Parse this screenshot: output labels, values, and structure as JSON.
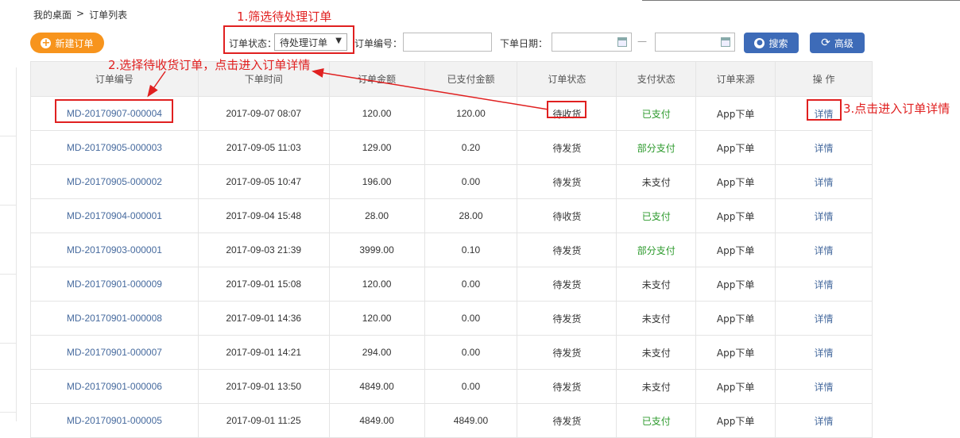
{
  "breadcrumb": {
    "home": "我的桌面",
    "separator": ">",
    "current": "订单列表"
  },
  "toolbar": {
    "new_order_label": "新建订单",
    "status_label": "订单状态：",
    "status_selected": "待处理订单",
    "order_no_label": "订单编号：",
    "order_no_value": "",
    "date_label": "下单日期：",
    "date_separator": "—",
    "date_from": "",
    "date_to": "",
    "search_label": "搜索",
    "advanced_label": "高级"
  },
  "annotations": {
    "step1": "1.筛选待处理订单",
    "step2": "2.选择待收货订单，点击进入订单详情",
    "step3": "3.点击进入订单详情",
    "color": "#e02020"
  },
  "table": {
    "columns": [
      "订单编号",
      "下单时间",
      "订单金额",
      "已支付金额",
      "订单状态",
      "支付状态",
      "订单来源",
      "操 作"
    ],
    "rows": [
      {
        "order_no": "MD-20170907-000004",
        "time": "2017-09-07 08:07",
        "amount": "120.00",
        "paid_amount": "120.00",
        "status": "待收货",
        "pay_status": "已支付",
        "source": "App下单",
        "action": "详情"
      },
      {
        "order_no": "MD-20170905-000003",
        "time": "2017-09-05 11:03",
        "amount": "129.00",
        "paid_amount": "0.20",
        "status": "待发货",
        "pay_status": "部分支付",
        "source": "App下单",
        "action": "详情"
      },
      {
        "order_no": "MD-20170905-000002",
        "time": "2017-09-05 10:47",
        "amount": "196.00",
        "paid_amount": "0.00",
        "status": "待发货",
        "pay_status": "未支付",
        "source": "App下单",
        "action": "详情"
      },
      {
        "order_no": "MD-20170904-000001",
        "time": "2017-09-04 15:48",
        "amount": "28.00",
        "paid_amount": "28.00",
        "status": "待收货",
        "pay_status": "已支付",
        "source": "App下单",
        "action": "详情"
      },
      {
        "order_no": "MD-20170903-000001",
        "time": "2017-09-03 21:39",
        "amount": "3999.00",
        "paid_amount": "0.10",
        "status": "待发货",
        "pay_status": "部分支付",
        "source": "App下单",
        "action": "详情"
      },
      {
        "order_no": "MD-20170901-000009",
        "time": "2017-09-01 15:08",
        "amount": "120.00",
        "paid_amount": "0.00",
        "status": "待发货",
        "pay_status": "未支付",
        "source": "App下单",
        "action": "详情"
      },
      {
        "order_no": "MD-20170901-000008",
        "time": "2017-09-01 14:36",
        "amount": "120.00",
        "paid_amount": "0.00",
        "status": "待发货",
        "pay_status": "未支付",
        "source": "App下单",
        "action": "详情"
      },
      {
        "order_no": "MD-20170901-000007",
        "time": "2017-09-01 14:21",
        "amount": "294.00",
        "paid_amount": "0.00",
        "status": "待发货",
        "pay_status": "未支付",
        "source": "App下单",
        "action": "详情"
      },
      {
        "order_no": "MD-20170901-000006",
        "time": "2017-09-01 13:50",
        "amount": "4849.00",
        "paid_amount": "0.00",
        "status": "待发货",
        "pay_status": "未支付",
        "source": "App下单",
        "action": "详情"
      },
      {
        "order_no": "MD-20170901-000005",
        "time": "2017-09-01 11:25",
        "amount": "4849.00",
        "paid_amount": "4849.00",
        "status": "待发货",
        "pay_status": "已支付",
        "source": "App下单",
        "action": "详情"
      }
    ]
  },
  "colors": {
    "accent_orange": "#f7941d",
    "button_blue": "#3d6bb8",
    "paid_green": "#2c9a2c",
    "link_blue": "#466a9e"
  },
  "icons": {
    "new_order": "plus-circle-icon",
    "search": "search-icon",
    "advanced": "refresh-icon",
    "calendar": "calendar-icon",
    "dropdown": "dropdown-arrow-icon"
  }
}
